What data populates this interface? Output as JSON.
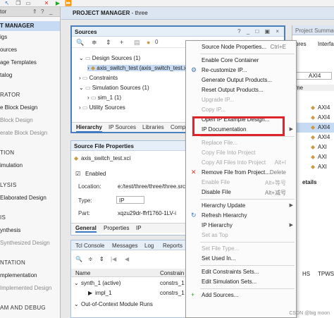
{
  "toolbar": {
    "icons": [
      "arrow-icon",
      "copy-icon",
      "close-icon",
      "run-icon",
      "run-all-icon"
    ]
  },
  "flow_navigator": {
    "title": "tor",
    "items": [
      {
        "label": "T MANAGER",
        "kind": "selected"
      },
      {
        "label": "igs",
        "kind": "normal"
      },
      {
        "label": "ources",
        "kind": "normal"
      },
      {
        "label": "age Templates",
        "kind": "normal"
      },
      {
        "label": "talog",
        "kind": "normal"
      },
      {
        "label": "RATOR",
        "kind": "section"
      },
      {
        "label": "e Block Design",
        "kind": "normal"
      },
      {
        "label": "Block Design",
        "kind": "dim"
      },
      {
        "label": "erate Block Design",
        "kind": "dim"
      },
      {
        "label": "TION",
        "kind": "section"
      },
      {
        "label": "imulation",
        "kind": "normal"
      },
      {
        "label": "LYSIS",
        "kind": "section"
      },
      {
        "label": "Elaborated Design",
        "kind": "normal"
      },
      {
        "label": "IS",
        "kind": "section"
      },
      {
        "label": "ynthesis",
        "kind": "normal"
      },
      {
        "label": "Synthesized Design",
        "kind": "dim"
      },
      {
        "label": "NTATION",
        "kind": "section"
      },
      {
        "label": "mplementation",
        "kind": "normal"
      },
      {
        "label": "Implemented Design",
        "kind": "dim"
      },
      {
        "label": "AM AND DEBUG",
        "kind": "section"
      }
    ]
  },
  "project_manager": {
    "title": "PROJECT MANAGER",
    "project": " - three"
  },
  "sources": {
    "title": "Sources",
    "header_buttons": "? _ □ ▣ ×",
    "badge": "0",
    "tree": [
      {
        "label": "Design Sources (1)",
        "level": 1
      },
      {
        "label": "axis_switch_test (axis_switch_test.x",
        "level": 2
      },
      {
        "label": "Constraints",
        "level": 1
      },
      {
        "label": "Simulation Sources (1)",
        "level": 1
      },
      {
        "label": "sim_1 (1)",
        "level": 2
      },
      {
        "label": "Utility Sources",
        "level": 1
      }
    ],
    "tabs": [
      "Hierarchy",
      "IP Sources",
      "Libraries",
      "Compile"
    ]
  },
  "source_file_properties": {
    "title": "Source File Properties",
    "file": "axis_switch_test.xci",
    "enabled_label": "Enabled",
    "location_label": "Location:",
    "location_value": "e:/test/three/three/three.srcs/s",
    "type_label": "Type:",
    "type_value": "IP",
    "part_label": "Part:",
    "part_value": "xqzu29dr-ffrf1760-1LV-i",
    "tabs": [
      "General",
      "Properties",
      "IP"
    ]
  },
  "bottom_panel": {
    "tabs": [
      "Tcl Console",
      "Messages",
      "Log",
      "Reports"
    ],
    "columns": [
      "Name",
      "Constrain"
    ],
    "rows": [
      {
        "name": "synth_1 (active)",
        "constraint": "constrs_1"
      },
      {
        "name": "impl_1",
        "constraint": "constrs_1"
      },
      {
        "name": "Out-of-Context Module Runs",
        "constraint": ""
      }
    ]
  },
  "project_summary": {
    "title": "Project Summar",
    "tabs": [
      "ores",
      "Interfa"
    ],
    "column": "me",
    "search": "AXI4",
    "rows": [
      "AXI4",
      "AXI4",
      "AXI4",
      "AXI4",
      "AXI",
      "AXI",
      "AXI"
    ],
    "details_label": "etails",
    "table_cols": [
      "HS",
      "TPWS"
    ]
  },
  "context_menu": {
    "items": [
      {
        "label": "Source Node Properties...",
        "shortcut": "Ctrl+E",
        "enabled": true
      },
      {
        "sep": true
      },
      {
        "label": "Enable Core Container",
        "enabled": true
      },
      {
        "label": "Re-customize IP...",
        "enabled": true,
        "icon": "customize-icon"
      },
      {
        "label": "Generate Output Products...",
        "enabled": true
      },
      {
        "label": "Reset Output Products...",
        "enabled": true
      },
      {
        "label": "Upgrade IP...",
        "enabled": false
      },
      {
        "label": "Copy IP...",
        "enabled": false
      },
      {
        "label": "Open IP Example Design...",
        "enabled": true
      },
      {
        "label": "IP Documentation",
        "enabled": true,
        "submenu": true
      },
      {
        "sep": true
      },
      {
        "label": "Replace File...",
        "enabled": false
      },
      {
        "label": "Copy File Into Project",
        "enabled": false
      },
      {
        "label": "Copy All Files Into Project",
        "shortcut": "Alt+I",
        "enabled": false
      },
      {
        "label": "Remove File from Project...",
        "shortcut": "Delete",
        "enabled": true,
        "icon": "remove-icon"
      },
      {
        "label": "Enable File",
        "shortcut": "Alt+等号",
        "enabled": false
      },
      {
        "label": "Disable File",
        "shortcut": "Alt+减号",
        "enabled": true
      },
      {
        "sep": true
      },
      {
        "label": "Hierarchy Update",
        "enabled": true,
        "submenu": true
      },
      {
        "label": "Refresh Hierarchy",
        "enabled": true,
        "icon": "refresh-icon"
      },
      {
        "label": "IP Hierarchy",
        "enabled": true,
        "submenu": true
      },
      {
        "label": "Set as Top",
        "enabled": false
      },
      {
        "sep": true
      },
      {
        "label": "Set File Type...",
        "enabled": false
      },
      {
        "label": "Set Used In...",
        "enabled": true
      },
      {
        "sep": true
      },
      {
        "label": "Edit Constraints Sets...",
        "enabled": true
      },
      {
        "label": "Edit Simulation Sets...",
        "enabled": true
      },
      {
        "sep": true
      },
      {
        "label": "Add Sources...",
        "enabled": true,
        "icon": "add-icon"
      }
    ]
  },
  "watermark": "CSDN @big moon",
  "colors": {
    "highlight": "#e0242b",
    "selection": "#c6daf3",
    "panel_header": "#e6eef8"
  }
}
